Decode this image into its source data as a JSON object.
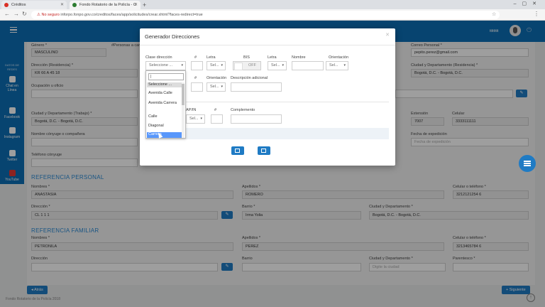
{
  "browser": {
    "tabs": [
      {
        "title": "Créditos"
      },
      {
        "title": "Fondo Rotatorio de la Policía - C"
      }
    ],
    "security_label": "No seguro",
    "url": "inforpo.fonpo.gov.co/creditos/faces/app/solicitudes/crear.xhtml?faces-redirect=true"
  },
  "header": {
    "username": "ttttttttt"
  },
  "sidebar": {
    "section_label": "DATOS DE REDES",
    "items": [
      {
        "label": "Chat en Línea"
      },
      {
        "label": "Facebook"
      },
      {
        "label": "Instagram"
      },
      {
        "label": "Twitter"
      },
      {
        "label": "YouTube"
      }
    ]
  },
  "form": {
    "genero": {
      "label": "Género *",
      "value": "MASCULINO"
    },
    "personas": {
      "label": "#Personas a cargo"
    },
    "correo": {
      "label": "Correo Personal *",
      "value": "pepito.perez@gmail.com"
    },
    "direccion": {
      "label": "Dirección (Residencia) *",
      "value": "KR 66 A 45 18"
    },
    "ciudad_res": {
      "label": "Ciudad y Departamento (Residencia) *",
      "value": "Bogotá, D.C. - Bogotá, D.C."
    },
    "ocupacion": {
      "label": "Ocupación u oficio"
    },
    "ciudad_trab": {
      "label": "Ciudad y Departamento (Trabajo) *",
      "value": "Bogotá, D.C. - Bogotá, D.C."
    },
    "extension": {
      "label": "Extensión",
      "value": "7007"
    },
    "celular": {
      "label": "Celular",
      "value": "3333111111"
    },
    "conyuge": {
      "label": "Nombre cónyuge o compañera"
    },
    "fecha_exp": {
      "label": "Fecha de expedición",
      "placeholder": "Fecha de expedición"
    },
    "tel_conyuge": {
      "label": "Teléfono cónyuge"
    }
  },
  "ref_personal": {
    "title": "REFERENCIA PERSONAL",
    "nombres": {
      "label": "Nombres *",
      "value": "ANASTASIA"
    },
    "apellidos": {
      "label": "Apellidos *",
      "value": "ROMERO"
    },
    "celular": {
      "label": "Celular o teléfono *",
      "value": "3212121254 6"
    },
    "direccion": {
      "label": "Dirección *",
      "value": "CL 1 1 1"
    },
    "barrio": {
      "label": "Barrio *",
      "value": "Irma Yolia"
    },
    "ciudad": {
      "label": "Ciudad y Departamento *",
      "value": "Bogotá, D.C. - Bogotá, D.C."
    }
  },
  "ref_familiar": {
    "title": "REFERENCIA FAMILIAR",
    "nombres": {
      "label": "Nombres *",
      "value": "PETRONILA"
    },
    "apellidos": {
      "label": "Apellidos *",
      "value": "PEREZ"
    },
    "celular": {
      "label": "Celular o teléfono *",
      "value": "3213465784 6"
    },
    "direccion": {
      "label": "Dirección"
    },
    "barrio": {
      "label": "Barrio"
    },
    "ciudad": {
      "label": "Ciudad y Departamento *",
      "placeholder": "Digite la ciudad"
    },
    "parentesco": {
      "label": "Parentesco *"
    }
  },
  "nav": {
    "back": "Atrás",
    "next": "Siguiente"
  },
  "footer": "Fondo Rotatorio de la Policía 2018",
  "modal": {
    "title": "Generador Direcciones",
    "row1": {
      "clase_label": "Clase dirección",
      "clase_value": "Seleccione ...",
      "num_label": "#",
      "letra_label": "Letra",
      "letra_value": "Sel...",
      "bis_label": "BIS",
      "bis_value": "OFF",
      "letra2_label": "Letra",
      "letra2_value": "Sel...",
      "nombre_label": "Nombre",
      "orient_label": "Orientación",
      "orient_value": "Sel..."
    },
    "row2": {
      "num_label": "#",
      "orient_label": "Orientación",
      "orient_value": "Sel...",
      "desc_label": "Descripción adicional"
    },
    "row3": {
      "apin_label": "AP/IN",
      "apin_value": "Sel...",
      "num_label": "#",
      "comp_label": "Complemento"
    }
  },
  "dropdown": {
    "search_value": "|",
    "options": [
      "Seleccione ...",
      "Avenida Calle",
      "Avenida Carrera",
      "Calle",
      "Diagonal",
      "Carrera"
    ],
    "selected_index": 0,
    "highlighted_index": 5
  },
  "colors": {
    "primary": "#0c6fb5",
    "button": "#1f7bc4",
    "section": "#2a8ad4"
  }
}
